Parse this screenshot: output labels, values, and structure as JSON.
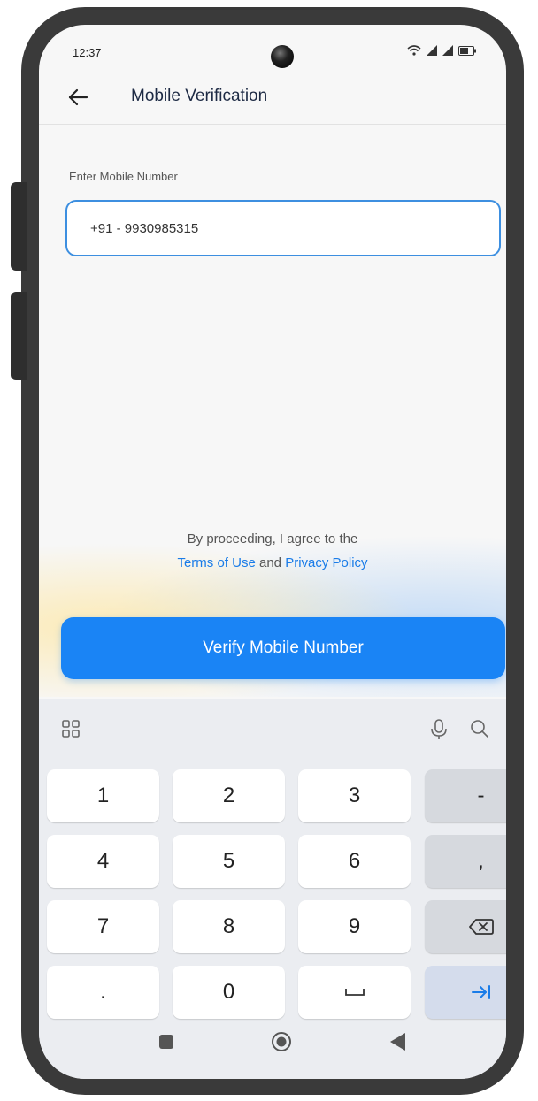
{
  "status_bar": {
    "time": "12:37"
  },
  "app_bar": {
    "title": "Mobile Verification"
  },
  "form": {
    "label": "Enter Mobile Number",
    "phone_value": "+91 - 9930985315"
  },
  "consent": {
    "text": "By proceeding, I agree to the",
    "terms_link": "Terms of Use",
    "and": "and",
    "privacy_link": "Privacy Policy"
  },
  "verify_button": {
    "label": "Verify Mobile Number"
  },
  "keyboard": {
    "toolbar_icons": [
      "grid-icon",
      "mic-icon",
      "search-icon"
    ],
    "keys": {
      "k1": "1",
      "k2": "2",
      "k3": "3",
      "dash": "-",
      "k4": "4",
      "k5": "5",
      "k6": "6",
      "comma": ",",
      "k7": "7",
      "k8": "8",
      "k9": "9",
      "dot": ".",
      "k0": "0"
    }
  },
  "colors": {
    "accent": "#1a84f5",
    "link": "#1a7ce8",
    "input_border": "#3d8fe0"
  }
}
